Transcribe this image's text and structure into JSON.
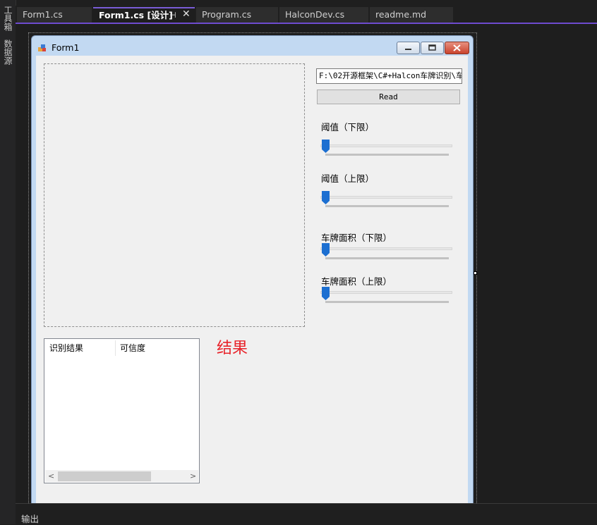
{
  "left_toolbar": {
    "items": [
      "工具箱",
      "数据源"
    ]
  },
  "tabs": [
    {
      "label": "Form1.cs",
      "active": false
    },
    {
      "label": "Form1.cs [设计]",
      "active": true
    },
    {
      "label": "Program.cs",
      "active": false
    },
    {
      "label": "HalconDev.cs",
      "active": false
    },
    {
      "label": "readme.md",
      "active": false
    }
  ],
  "tab_icons": {
    "pin": "pin-icon",
    "close": "close-icon"
  },
  "form": {
    "title": "Form1",
    "path_value": "F:\\02开源框架\\C#+Halcon车牌识别\\车",
    "read_button": "Read",
    "sliders": [
      {
        "label": "阈值（下限）",
        "value": 0
      },
      {
        "label": "阈值（上限）",
        "value": 0
      },
      {
        "label": "车牌面积（下限）",
        "value": 0
      },
      {
        "label": "车牌面积（上限）",
        "value": 0
      }
    ],
    "list_columns": [
      "识别结果",
      "可信度"
    ],
    "result_label": "结果"
  },
  "output_panel": {
    "label": "输出"
  },
  "colors": {
    "accent": "#7a5cd6",
    "result_text": "#e8232a",
    "slider_thumb": "#1c6fd1"
  }
}
